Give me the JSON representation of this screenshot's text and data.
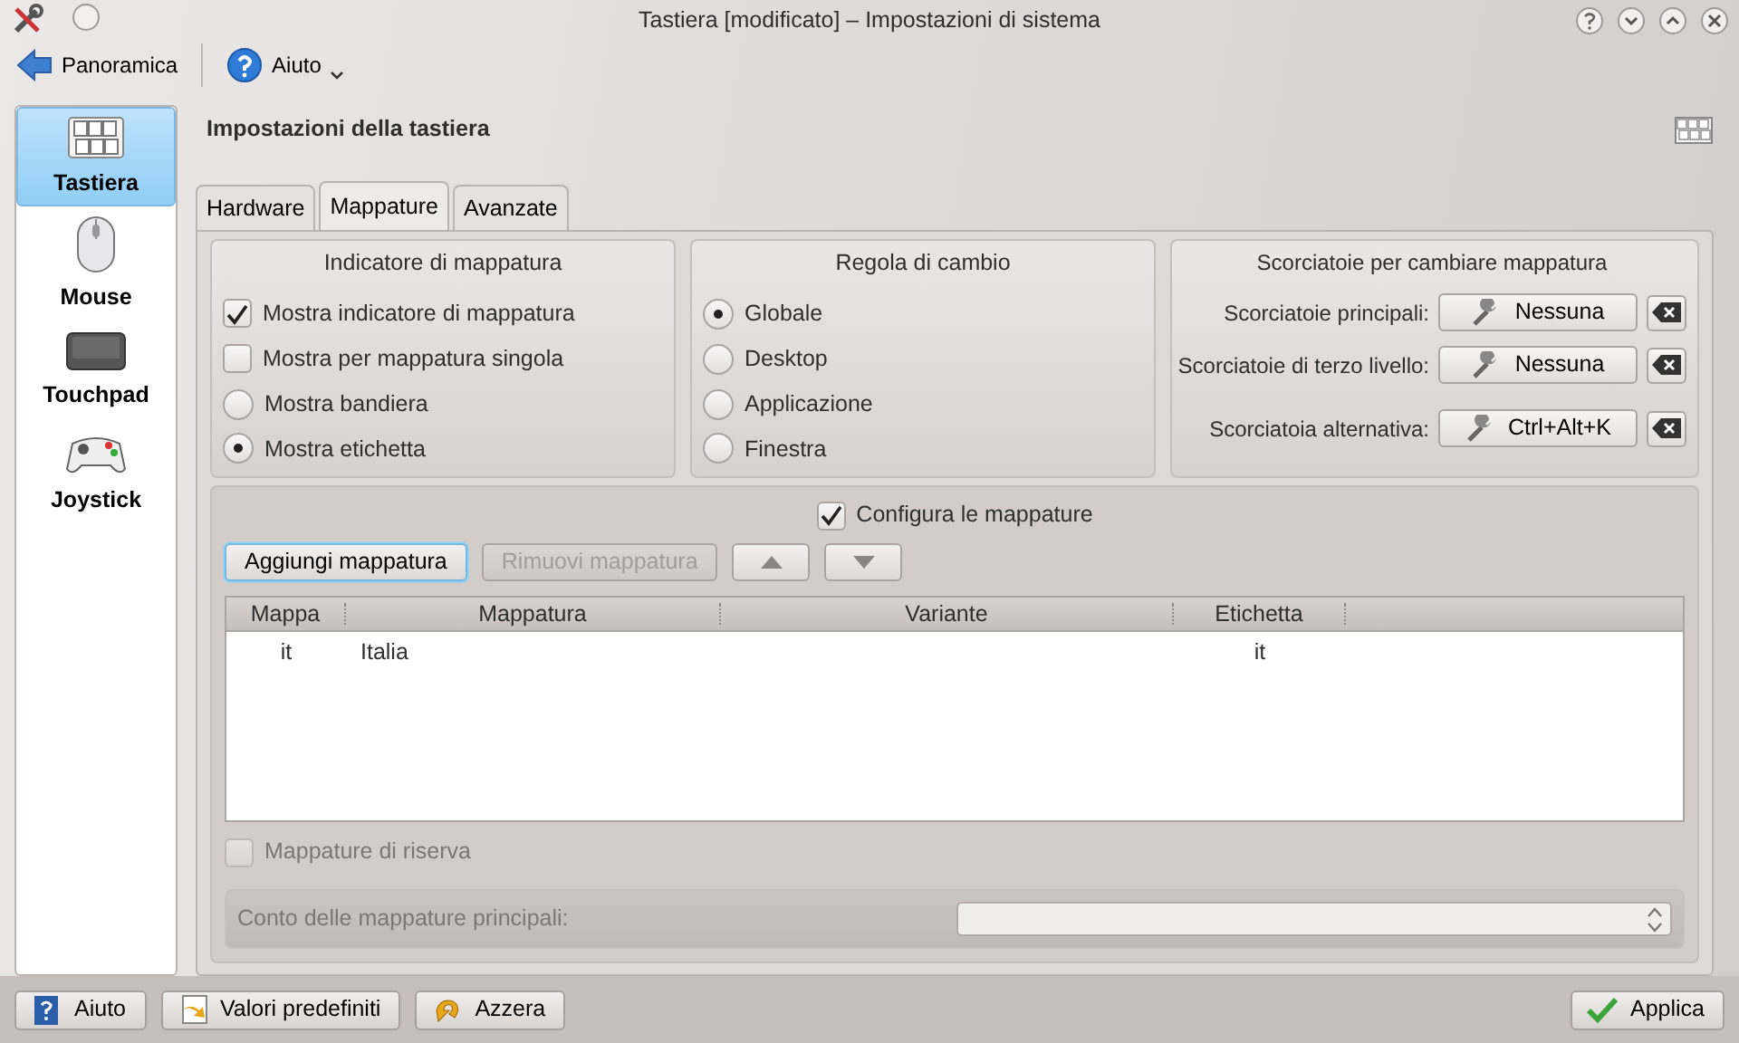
{
  "window": {
    "title": "Tastiera [modificato] – Impostazioni di sistema"
  },
  "toolbar": [
    {
      "kind": "back",
      "label": "Panoramica"
    },
    {
      "kind": "help",
      "label": "Aiuto"
    }
  ],
  "sidebar": {
    "items": [
      {
        "kind": "keyboard",
        "label": "Tastiera",
        "selected": true
      },
      {
        "kind": "mouse",
        "label": "Mouse",
        "selected": false
      },
      {
        "kind": "touchpad",
        "label": "Touchpad",
        "selected": false
      },
      {
        "kind": "joystick",
        "label": "Joystick",
        "selected": false
      }
    ]
  },
  "header": "Impostazioni della tastiera",
  "tabs": [
    {
      "label": "Hardware",
      "selected": false
    },
    {
      "label": "Mappature",
      "selected": true
    },
    {
      "label": "Avanzate",
      "selected": false
    }
  ],
  "indicator": {
    "title": "Indicatore di mappatura",
    "options": [
      {
        "kind": "checkbox",
        "label": "Mostra indicatore di mappatura",
        "checked": true
      },
      {
        "kind": "checkbox",
        "label": "Mostra per mappatura singola",
        "checked": false
      },
      {
        "kind": "radio",
        "label": "Mostra bandiera",
        "checked": false
      },
      {
        "kind": "radio",
        "label": "Mostra etichetta",
        "checked": true
      }
    ]
  },
  "switching": {
    "title": "Regola di cambio",
    "options": [
      {
        "kind": "radio",
        "label": "Globale",
        "checked": true
      },
      {
        "kind": "radio",
        "label": "Desktop",
        "checked": false
      },
      {
        "kind": "radio",
        "label": "Applicazione",
        "checked": false
      },
      {
        "kind": "radio",
        "label": "Finestra",
        "checked": false
      }
    ]
  },
  "shortcuts": {
    "title": "Scorciatoie per cambiare mappatura",
    "rows": [
      {
        "label": "Scorciatoie principali:",
        "value": "Nessuna"
      },
      {
        "label": "Scorciatoie di terzo livello:",
        "value": "Nessuna"
      },
      {
        "label": "Scorciatoia alternativa:",
        "value": "Ctrl+Alt+K"
      }
    ]
  },
  "layouts": {
    "configure": {
      "label": "Configura le mappature",
      "checked": true
    },
    "buttons": [
      {
        "kind": "text",
        "label": "Aggiungi mappatura",
        "disabled": false
      },
      {
        "kind": "text",
        "label": "Rimuovi mappatura",
        "disabled": true
      },
      {
        "kind": "up",
        "disabled": false
      },
      {
        "kind": "down",
        "disabled": false
      }
    ],
    "table": {
      "columns": [
        "Mappa",
        "Mappatura",
        "Variante",
        "Etichetta"
      ],
      "rows": [
        [
          "it",
          "Italia",
          "",
          "it"
        ]
      ]
    },
    "spare": {
      "label": "Mappature di riserva",
      "checked": false,
      "disabled": true
    },
    "count": {
      "label": "Conto delle mappature principali:",
      "disabled": true
    }
  },
  "footer": [
    {
      "kind": "help",
      "label": "Aiuto"
    },
    {
      "kind": "defaults",
      "label": "Valori predefiniti"
    },
    {
      "kind": "reset",
      "label": "Azzera"
    },
    {
      "kind": "apply",
      "label": "Applica"
    }
  ]
}
